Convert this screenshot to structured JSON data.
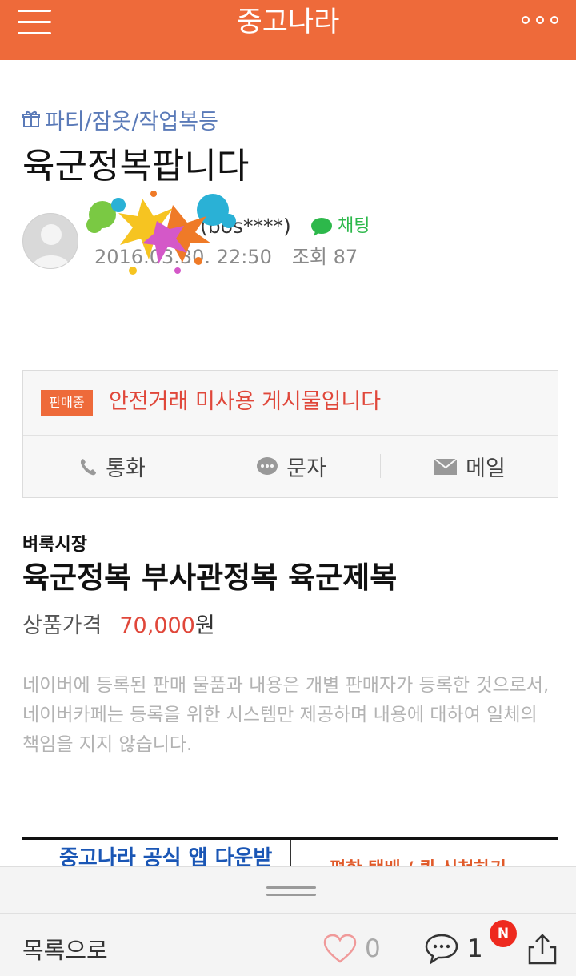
{
  "header": {
    "title": "중고나라",
    "menu_icon": "hamburger-menu-icon",
    "more_icon": "more-dots-icon",
    "bg_color": "#ee6a3a"
  },
  "post": {
    "category": "파티/잠옷/작업복등",
    "title": "육군정복팝니다",
    "author": "(bos****)",
    "chat_label": "채팅",
    "datetime": "2016.03.30. 22:50",
    "views": "조회 87"
  },
  "trade": {
    "status_badge": "판매중",
    "safe_notice": "안전거래 미사용 게시물입니다",
    "actions": [
      {
        "label": "통화",
        "icon": "phone-icon"
      },
      {
        "label": "문자",
        "icon": "sms-bubble-icon"
      },
      {
        "label": "메일",
        "icon": "mail-envelope-icon"
      }
    ]
  },
  "product": {
    "shop_name": "벼룩시장",
    "title": "육군정복 부사관정복 육군제복",
    "price_label": "상품가격",
    "price_value": "70,000",
    "price_unit": "원",
    "disclaimer": "네이버에 등록된 판매 물품과 내용은 개별 판매자가 등록한 것으로서, 네이버카페는 등록을 위한 시스템만 제공하며 내용에 대하여 일체의 책임을 지지 않습니다."
  },
  "banner": {
    "left_text": "중고나라 공식 앱 다운받",
    "right_text": "편한 택배 / 퀵 신청하기"
  },
  "bottom_bar": {
    "back_label": "목록으로",
    "like_count": "0",
    "comment_count": "1",
    "new_badge": "N"
  }
}
